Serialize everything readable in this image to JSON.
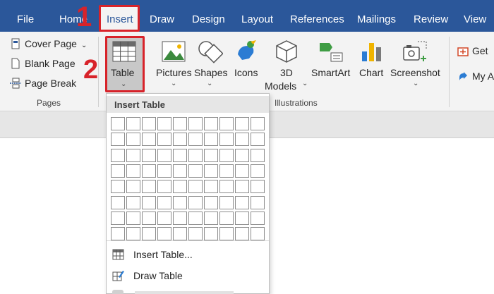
{
  "tabs": [
    {
      "label": "File"
    },
    {
      "label": "Home"
    },
    {
      "label": "Insert",
      "active": true
    },
    {
      "label": "Draw"
    },
    {
      "label": "Design"
    },
    {
      "label": "Layout"
    },
    {
      "label": "References"
    },
    {
      "label": "Mailings"
    },
    {
      "label": "Review"
    },
    {
      "label": "View"
    }
  ],
  "steps": {
    "one": "1",
    "two": "2"
  },
  "ribbon": {
    "pages": {
      "cover_page": "Cover Page",
      "blank_page": "Blank Page",
      "page_break": "Page Break",
      "group_label": "Pages"
    },
    "tables": {
      "table": "Table"
    },
    "illustrations": {
      "pictures": "Pictures",
      "shapes": "Shapes",
      "icons": "Icons",
      "models_3d_line1": "3D",
      "models_3d_line2": "Models",
      "smartart": "SmartArt",
      "chart": "Chart",
      "screenshot": "Screenshot",
      "group_label": "Illustrations"
    },
    "addins": {
      "get": "Get",
      "my": "My A"
    }
  },
  "dropdown": {
    "header": "Insert Table",
    "grid": {
      "columns": 10,
      "rows": 8
    },
    "items": {
      "insert_table": "Insert Table...",
      "draw_table": "Draw Table"
    }
  },
  "colors": {
    "brand_blue": "#2b579a",
    "highlight_red": "#d8232a",
    "ribbon_bg": "#f3f3f3"
  }
}
